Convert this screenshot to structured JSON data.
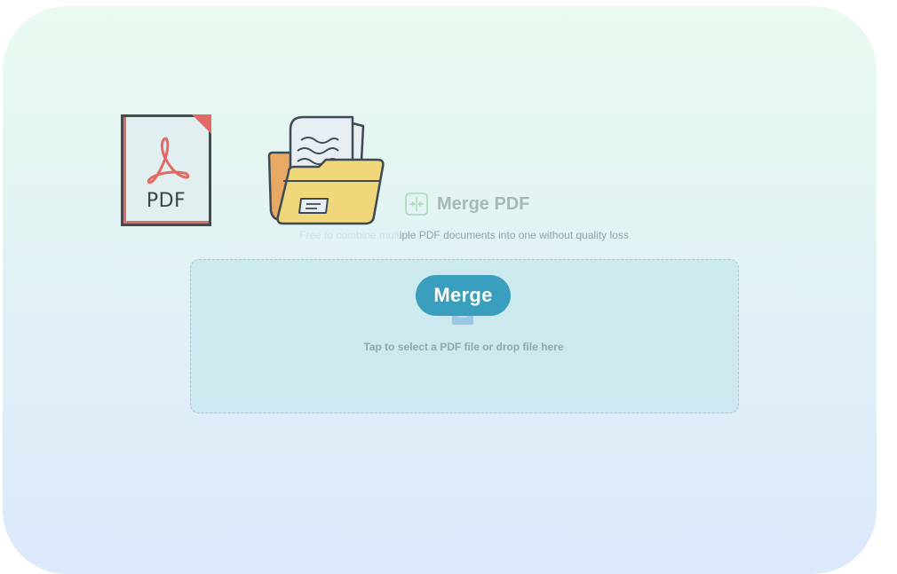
{
  "pdf_icon": {
    "label": "PDF"
  },
  "header": {
    "title": "Merge PDF",
    "subtitle_faded": "Free to combine mult",
    "subtitle": "iple PDF documents into one without quality loss"
  },
  "dropzone": {
    "button_label": "Merge",
    "hint": "Tap to select a PDF file or drop file here"
  },
  "colors": {
    "accent": "#3a9fbe",
    "pdf_red": "#e36a64",
    "folder_yellow": "#efd77a"
  },
  "icons": {
    "pdf": "pdf-file-icon",
    "folder": "folder-documents-icon",
    "merge": "merge-arrows-icon",
    "upload": "upload-icon"
  }
}
